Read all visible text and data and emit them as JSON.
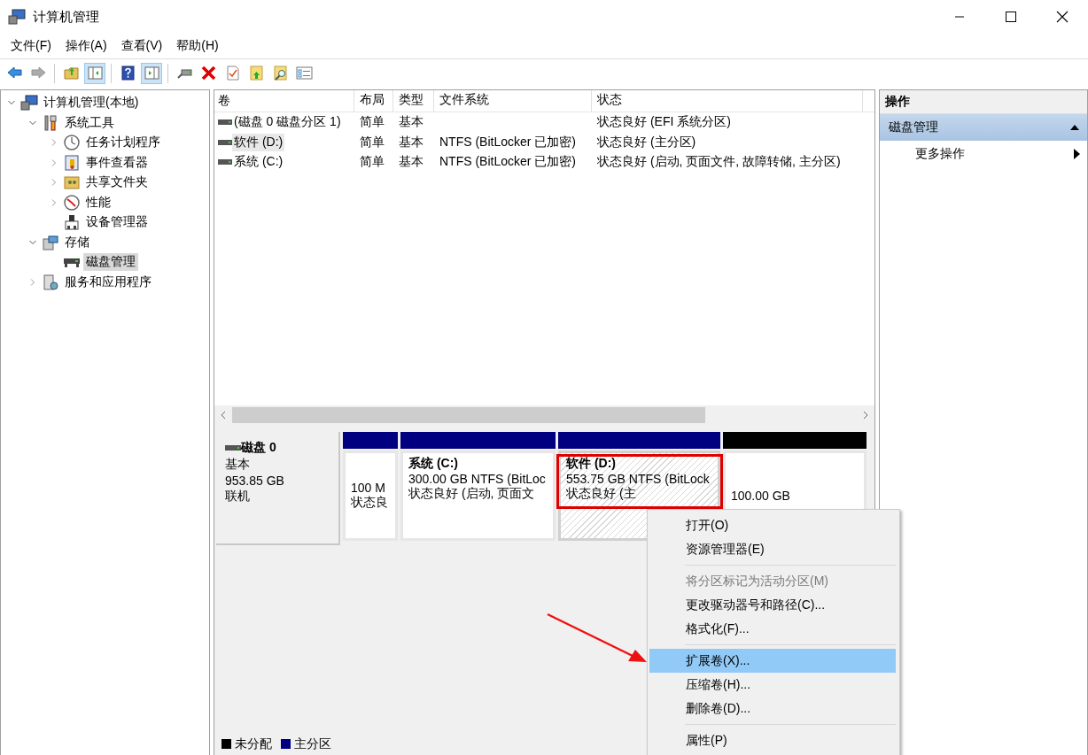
{
  "window": {
    "title": "计算机管理"
  },
  "menu": [
    "文件(F)",
    "操作(A)",
    "查看(V)",
    "帮助(H)"
  ],
  "toolbar": [
    {
      "kind": "back",
      "disabled": false,
      "pressed": false
    },
    {
      "kind": "forward",
      "disabled": true,
      "pressed": false
    },
    {
      "kind": "sep"
    },
    {
      "kind": "up",
      "disabled": false,
      "pressed": false
    },
    {
      "kind": "tree",
      "disabled": false,
      "pressed": true
    },
    {
      "kind": "sep"
    },
    {
      "kind": "help",
      "disabled": false,
      "pressed": false
    },
    {
      "kind": "pane",
      "disabled": false,
      "pressed": true
    },
    {
      "kind": "sep"
    },
    {
      "kind": "connect",
      "disabled": false,
      "pressed": false
    },
    {
      "kind": "delete",
      "disabled": false,
      "pressed": false
    },
    {
      "kind": "check",
      "disabled": false,
      "pressed": false
    },
    {
      "kind": "folderup",
      "disabled": false,
      "pressed": false
    },
    {
      "kind": "foldersearch",
      "disabled": false,
      "pressed": false
    },
    {
      "kind": "list",
      "disabled": false,
      "pressed": false
    }
  ],
  "tree": [
    {
      "label": "计算机管理(本地)",
      "kind": "computer",
      "selected": false,
      "expanded": true,
      "children": [
        {
          "label": "系统工具",
          "kind": "tools",
          "selected": false,
          "expanded": true,
          "children": [
            {
              "label": "任务计划程序",
              "kind": "clock",
              "selected": false,
              "expanded": false
            },
            {
              "label": "事件查看器",
              "kind": "log",
              "selected": false,
              "expanded": false
            },
            {
              "label": "共享文件夹",
              "kind": "share",
              "selected": false,
              "expanded": false
            },
            {
              "label": "性能",
              "kind": "perf",
              "selected": false,
              "expanded": false
            },
            {
              "label": "设备管理器",
              "kind": "device",
              "selected": false
            }
          ]
        },
        {
          "label": "存储",
          "kind": "storage",
          "selected": false,
          "expanded": true,
          "children": [
            {
              "label": "磁盘管理",
              "kind": "disk",
              "selected": true
            }
          ]
        },
        {
          "label": "服务和应用程序",
          "kind": "services",
          "selected": false,
          "expanded": false
        }
      ]
    }
  ],
  "table": {
    "columns": [
      "卷",
      "布局",
      "类型",
      "文件系统",
      "状态"
    ],
    "rows": [
      {
        "selected": false,
        "cells": [
          "(磁盘 0 磁盘分区 1)",
          "简单",
          "基本",
          "",
          "状态良好 (EFI 系统分区)"
        ]
      },
      {
        "selected": true,
        "cells": [
          "软件 (D:)",
          "简单",
          "基本",
          "NTFS (BitLocker 已加密)",
          "状态良好 (主分区)"
        ]
      },
      {
        "selected": false,
        "cells": [
          "系统 (C:)",
          "简单",
          "基本",
          "NTFS (BitLocker 已加密)",
          "状态良好 (启动, 页面文件, 故障转储, 主分区)"
        ]
      }
    ]
  },
  "disk": {
    "name": "磁盘 0",
    "type": "基本",
    "size": "953.85 GB",
    "status": "联机",
    "partitions": [
      {
        "kind": "primary",
        "selected": false,
        "highlighted": false,
        "lines": [
          "100 M",
          "状态良"
        ]
      },
      {
        "kind": "primary",
        "selected": false,
        "highlighted": false,
        "title": "系统 (C:)",
        "lines": [
          "300.00 GB NTFS (BitLoc",
          "状态良好 (启动, 页面文"
        ]
      },
      {
        "kind": "primary",
        "selected": true,
        "highlighted": true,
        "title": "软件 (D:)",
        "lines": [
          "553.75 GB NTFS (BitLock",
          "状态良好 (主"
        ]
      },
      {
        "kind": "unallocated",
        "selected": false,
        "highlighted": false,
        "lines": [
          "100.00 GB"
        ]
      }
    ]
  },
  "legend": [
    {
      "label": "未分配",
      "color": "#000000"
    },
    {
      "label": "主分区",
      "color": "#000080"
    }
  ],
  "actions": {
    "title": "操作",
    "section": "磁盘管理",
    "expanded": true,
    "items": [
      "更多操作"
    ]
  },
  "context_menu": [
    {
      "kind": "item",
      "label": "打开(O)",
      "disabled": false,
      "selected": false
    },
    {
      "kind": "item",
      "label": "资源管理器(E)",
      "disabled": false,
      "selected": false
    },
    {
      "kind": "separator"
    },
    {
      "kind": "item",
      "label": "将分区标记为活动分区(M)",
      "disabled": true,
      "selected": false
    },
    {
      "kind": "item",
      "label": "更改驱动器号和路径(C)...",
      "disabled": false,
      "selected": false
    },
    {
      "kind": "item",
      "label": "格式化(F)...",
      "disabled": false,
      "selected": false
    },
    {
      "kind": "separator"
    },
    {
      "kind": "item",
      "label": "扩展卷(X)...",
      "disabled": false,
      "selected": true,
      "arrow": true
    },
    {
      "kind": "item",
      "label": "压缩卷(H)...",
      "disabled": false,
      "selected": false
    },
    {
      "kind": "item",
      "label": "删除卷(D)...",
      "disabled": false,
      "selected": false
    },
    {
      "kind": "separator"
    },
    {
      "kind": "item",
      "label": "属性(P)",
      "disabled": false,
      "selected": false
    }
  ]
}
